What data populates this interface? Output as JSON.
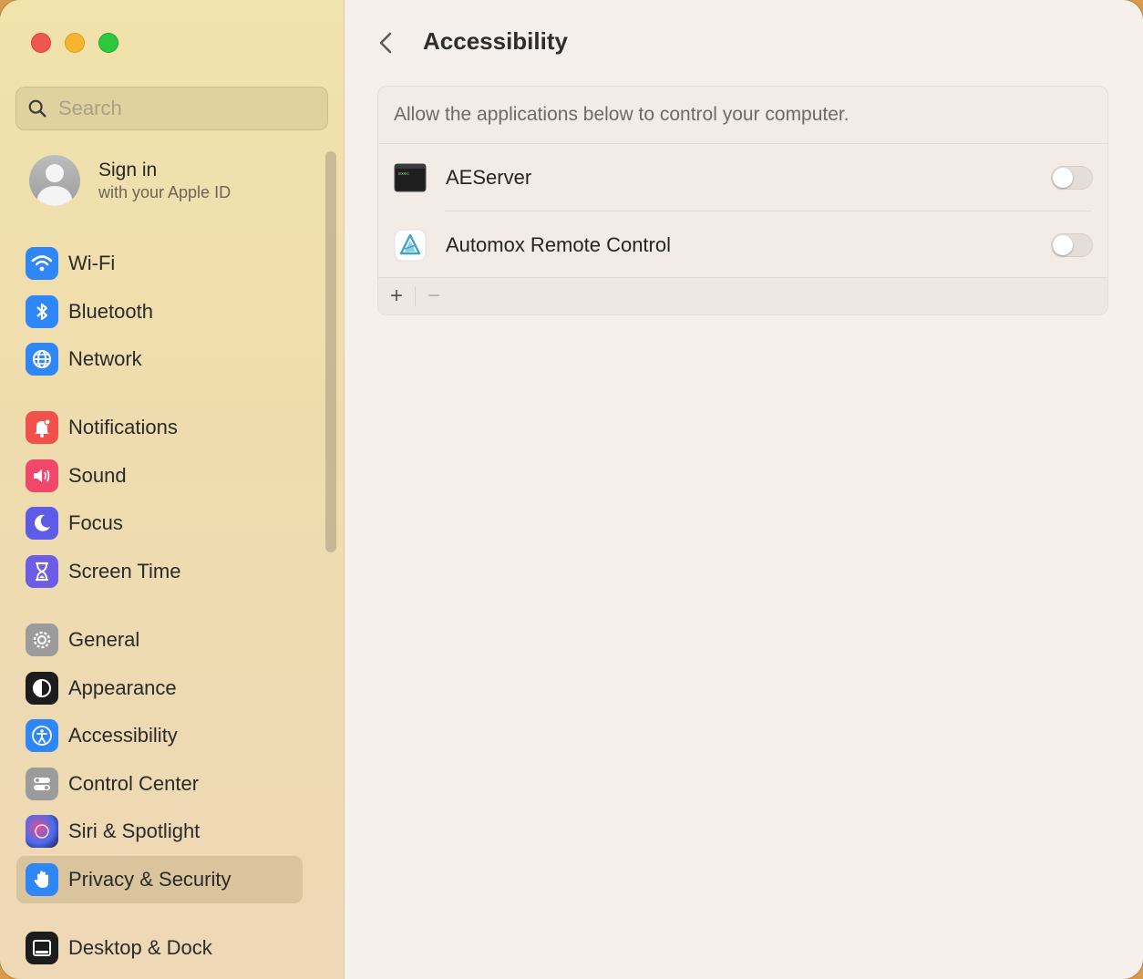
{
  "window": {
    "title": "Accessibility"
  },
  "search": {
    "placeholder": "Search"
  },
  "account": {
    "title": "Sign in",
    "subtitle": "with your Apple ID"
  },
  "sidebar": {
    "items": [
      {
        "label": "Wi-Fi",
        "icon": "wifi-icon",
        "color": "#2f86f6"
      },
      {
        "label": "Bluetooth",
        "icon": "bluetooth-icon",
        "color": "#2f86f6"
      },
      {
        "label": "Network",
        "icon": "globe-icon",
        "color": "#2f86f6"
      },
      {
        "label": "Notifications",
        "icon": "bell-icon",
        "color": "#f2504b"
      },
      {
        "label": "Sound",
        "icon": "speaker-icon",
        "color": "#f0476a"
      },
      {
        "label": "Focus",
        "icon": "moon-icon",
        "color": "#5e5ce6"
      },
      {
        "label": "Screen Time",
        "icon": "hourglass-icon",
        "color": "#6d5ce6"
      },
      {
        "label": "General",
        "icon": "gear-icon",
        "color": "#9b9b9b"
      },
      {
        "label": "Appearance",
        "icon": "appearance-icon",
        "color": "#1c1c1c"
      },
      {
        "label": "Accessibility",
        "icon": "accessibility-icon",
        "color": "#2f86f6"
      },
      {
        "label": "Control Center",
        "icon": "control-center-icon",
        "color": "#9b9b9b"
      },
      {
        "label": "Siri & Spotlight",
        "icon": "siri-icon",
        "color": "#3b2b6a"
      },
      {
        "label": "Privacy & Security",
        "icon": "hand-icon",
        "color": "#2f86f6"
      },
      {
        "label": "Desktop & Dock",
        "icon": "dock-icon",
        "color": "#1c1c1c"
      }
    ],
    "selected": "Privacy & Security"
  },
  "main": {
    "description": "Allow the applications below to control your computer.",
    "apps": [
      {
        "name": "AEServer",
        "icon": "terminal-app-icon",
        "enabled": false
      },
      {
        "name": "Automox Remote Control",
        "icon": "automox-app-icon",
        "enabled": false
      }
    ],
    "footer": {
      "add_label": "+",
      "remove_label": "−"
    }
  }
}
